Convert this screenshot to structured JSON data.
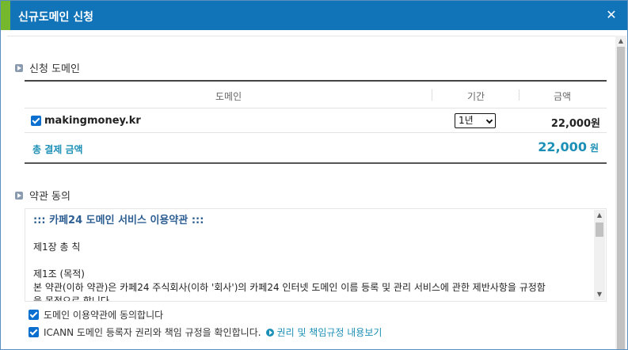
{
  "window": {
    "title": "신규도메인 신청",
    "close_glyph": "✕"
  },
  "sections": {
    "domain_title": "신청 도메인",
    "terms_title": "약관 동의"
  },
  "table": {
    "headers": [
      "도메인",
      "기간",
      "금액"
    ],
    "rows": [
      {
        "domain": "makingmoney.kr",
        "period": "1년",
        "price": "22,000원"
      }
    ],
    "total_label": "총 결제 금액",
    "total_amount": "22,000",
    "total_currency": "원"
  },
  "terms": {
    "heading": "::: 카페24 도메인 서비스 이용약관 :::",
    "chapter": "제1장 총 칙",
    "article": "제1조 (목적)",
    "body": "본 약관(이하 약관)은 카페24 주식회사(이하 '회사')의 카페24 인터넷 도메인 이름 등록 및 관리 서비스에 관한 제반사항을 규정함",
    "body_cont": "을 목적으로 합니다."
  },
  "agreements": {
    "agree_terms": "도메인 이용약관에 동의합니다",
    "agree_icann": "ICANN 도메인 등록자 권리와 책임 규정을 확인합니다.",
    "icann_link": "권리 및 책임규정 내용보기"
  },
  "colors": {
    "titlebar": "#1173b8",
    "accent": "#75b82e",
    "highlight": "#1b8fb5",
    "checkbox": "#0b6fd0"
  }
}
